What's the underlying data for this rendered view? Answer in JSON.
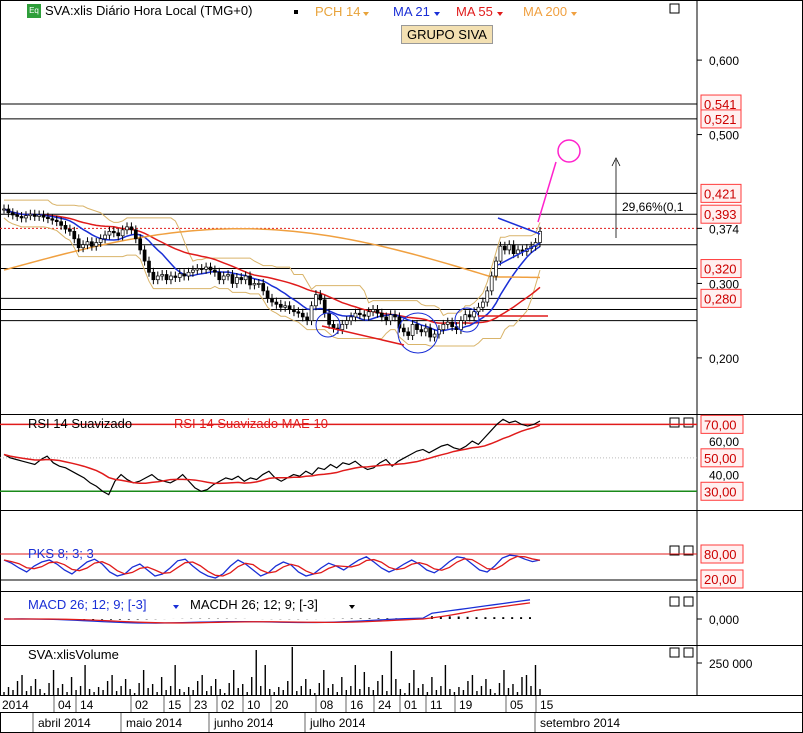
{
  "window_title": "SVA:xlis Diário Hora Local (TMG+0)",
  "eq_badge": "Eq",
  "legend": [
    {
      "label": "PCH 14",
      "color": "#e8a33a"
    },
    {
      "label": "MA 21",
      "color": "#1a2fd6"
    },
    {
      "label": "MA 55",
      "color": "#e01b1b"
    },
    {
      "label": "MA 200",
      "color": "#f0a040"
    }
  ],
  "group_label": "GRUPO SIVA",
  "annotation_pct": "29,66%(0,1",
  "chart_data": [
    {
      "type": "candlestick",
      "panel": "price",
      "title": "SVA:xlis Diário Hora Local (TMG+0)",
      "y_ticks": [
        "0,600",
        "0,500",
        "0,374",
        "0,300",
        "0,200"
      ],
      "price_labels": [
        "0,541",
        "0,521",
        "0,421",
        "0,393",
        "0,320",
        "0,280"
      ],
      "horizontal_levels": [
        0.541,
        0.521,
        0.421,
        0.393,
        0.374,
        0.352,
        0.32,
        0.28,
        0.265,
        0.25
      ],
      "dotted_level": 0.374,
      "ylim": [
        0.13,
        0.67
      ],
      "close": [
        0.4,
        0.395,
        0.392,
        0.39,
        0.388,
        0.391,
        0.393,
        0.39,
        0.392,
        0.389,
        0.387,
        0.385,
        0.383,
        0.378,
        0.373,
        0.37,
        0.36,
        0.348,
        0.352,
        0.356,
        0.35,
        0.355,
        0.36,
        0.365,
        0.37,
        0.368,
        0.364,
        0.372,
        0.376,
        0.372,
        0.36,
        0.345,
        0.33,
        0.315,
        0.305,
        0.31,
        0.312,
        0.305,
        0.31,
        0.308,
        0.313,
        0.31,
        0.315,
        0.318,
        0.32,
        0.319,
        0.322,
        0.318,
        0.315,
        0.305,
        0.31,
        0.312,
        0.3,
        0.308,
        0.305,
        0.31,
        0.298,
        0.3,
        0.3,
        0.29,
        0.28,
        0.275,
        0.272,
        0.268,
        0.27,
        0.265,
        0.262,
        0.26,
        0.255,
        0.25,
        0.27,
        0.285,
        0.278,
        0.26,
        0.245,
        0.24,
        0.238,
        0.245,
        0.25,
        0.255,
        0.26,
        0.258,
        0.256,
        0.262,
        0.265,
        0.26,
        0.255,
        0.25,
        0.258,
        0.255,
        0.24,
        0.235,
        0.23,
        0.245,
        0.238,
        0.235,
        0.24,
        0.228,
        0.232,
        0.238,
        0.245,
        0.248,
        0.242,
        0.238,
        0.25,
        0.258,
        0.255,
        0.262,
        0.268,
        0.275,
        0.29,
        0.31,
        0.33,
        0.35,
        0.345,
        0.352,
        0.34,
        0.345,
        0.343,
        0.347,
        0.35,
        0.355,
        0.37
      ]
    },
    {
      "type": "line",
      "panel": "rsi",
      "title": "RSI 14 Suavizado",
      "series": [
        {
          "name": "RSI 14 Suavizado",
          "color": "#000000"
        },
        {
          "name": "RSI 14 Suavizado MAE 10",
          "color": "#e01b1b"
        }
      ],
      "y_ticks": [
        "60,00",
        "40,00"
      ],
      "levels": [
        "70,00",
        "50,00",
        "30,00"
      ],
      "rsi": [
        52,
        50,
        49,
        48,
        47,
        46,
        49,
        51,
        47,
        45,
        44,
        42,
        40,
        38,
        35,
        33,
        30,
        28,
        36,
        40,
        37,
        35,
        36,
        38,
        40,
        37,
        36,
        35,
        37,
        40,
        36,
        32,
        30,
        31,
        34,
        36,
        38,
        37,
        39,
        36,
        38,
        37,
        40,
        42,
        38,
        36,
        38,
        40,
        39,
        42,
        40,
        44,
        43,
        46,
        44,
        47,
        46,
        48,
        45,
        43,
        44,
        47,
        49,
        45,
        48,
        50,
        52,
        54,
        55,
        53,
        55,
        57,
        58,
        56,
        55,
        57,
        60,
        58,
        62,
        66,
        70,
        73,
        71,
        72,
        70,
        69,
        70,
        72
      ]
    },
    {
      "type": "line",
      "panel": "pks",
      "title": "PKS 8; 3; 3",
      "y_ticks": [
        "80,00",
        "20,00"
      ],
      "pks": [
        70,
        62,
        50,
        40,
        55,
        65,
        70,
        60,
        45,
        35,
        50,
        65,
        72,
        60,
        40,
        30,
        35,
        52,
        60,
        45,
        30,
        35,
        50,
        68,
        72,
        55,
        40,
        30,
        25,
        35,
        55,
        70,
        60,
        45,
        30,
        38,
        55,
        65,
        58,
        40,
        30,
        35,
        50,
        62,
        55,
        45,
        58,
        70,
        78,
        65,
        50,
        40,
        48,
        60,
        70,
        60,
        45,
        38,
        50,
        66,
        78,
        75,
        60,
        45,
        40,
        55,
        75,
        82,
        80,
        72,
        66,
        70
      ]
    },
    {
      "type": "line",
      "panel": "macd",
      "title": "MACD 26; 12; 9; [-3]",
      "series": [
        {
          "name": "MACD 26; 12; 9; [-3]",
          "color": "#1a2fd6"
        },
        {
          "name": "MACDH 26; 12; 9; [-3]",
          "color": "#000000"
        }
      ],
      "y_ticks": [
        "0,000"
      ]
    },
    {
      "type": "bar",
      "panel": "volume",
      "title": "SVA:xlisVolume",
      "y_ticks": [
        "250 000"
      ]
    }
  ],
  "x_axis": {
    "day_labels": [
      "2014",
      "04",
      "14",
      "02",
      "15",
      "23",
      "02",
      "10",
      "20",
      "08",
      "16",
      "24",
      "01",
      "11",
      "19",
      "05",
      "15"
    ],
    "month_labels": [
      "abril 2014",
      "maio 2014",
      "junho 2014",
      "julho 2014",
      "setembro 2014"
    ]
  }
}
